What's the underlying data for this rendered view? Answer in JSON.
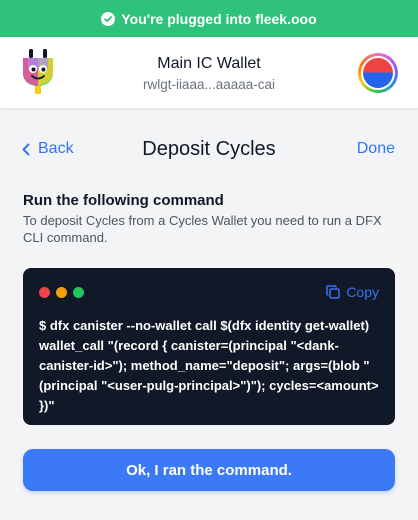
{
  "banner": {
    "text": "You're plugged into",
    "site": "fleek.ooo",
    "color": "#2fc27a",
    "icon": "check-circle-icon"
  },
  "header": {
    "logo": "plug-logo",
    "wallet_name": "Main IC Wallet",
    "principal": "rwlgt-iiaaa...aaaaa-cai",
    "avatar": "wallet-avatar"
  },
  "nav": {
    "back_label": "Back",
    "title": "Deposit Cycles",
    "done_label": "Done",
    "back_icon": "chevron-left-icon"
  },
  "content": {
    "heading": "Run the following command",
    "description": "To deposit Cycles from a Cycles Wallet you need to run a DFX CLI command."
  },
  "terminal": {
    "copy_label": "Copy",
    "copy_icon": "copy-icon",
    "command": "$ dfx canister --no-wallet call $(dfx identity get-wallet) wallet_call \"(record { canister=(principal \"<dank-canister-id>\"); method_name=\"deposit\"; args=(blob \"(principal \"<user-pulg-principal>\")\"); cycles=<amount> })\""
  },
  "actions": {
    "confirm_label": "Ok, I ran the command."
  },
  "colors": {
    "accent": "#3574f0",
    "button": "#3b79f5",
    "terminal_bg": "#111827"
  }
}
